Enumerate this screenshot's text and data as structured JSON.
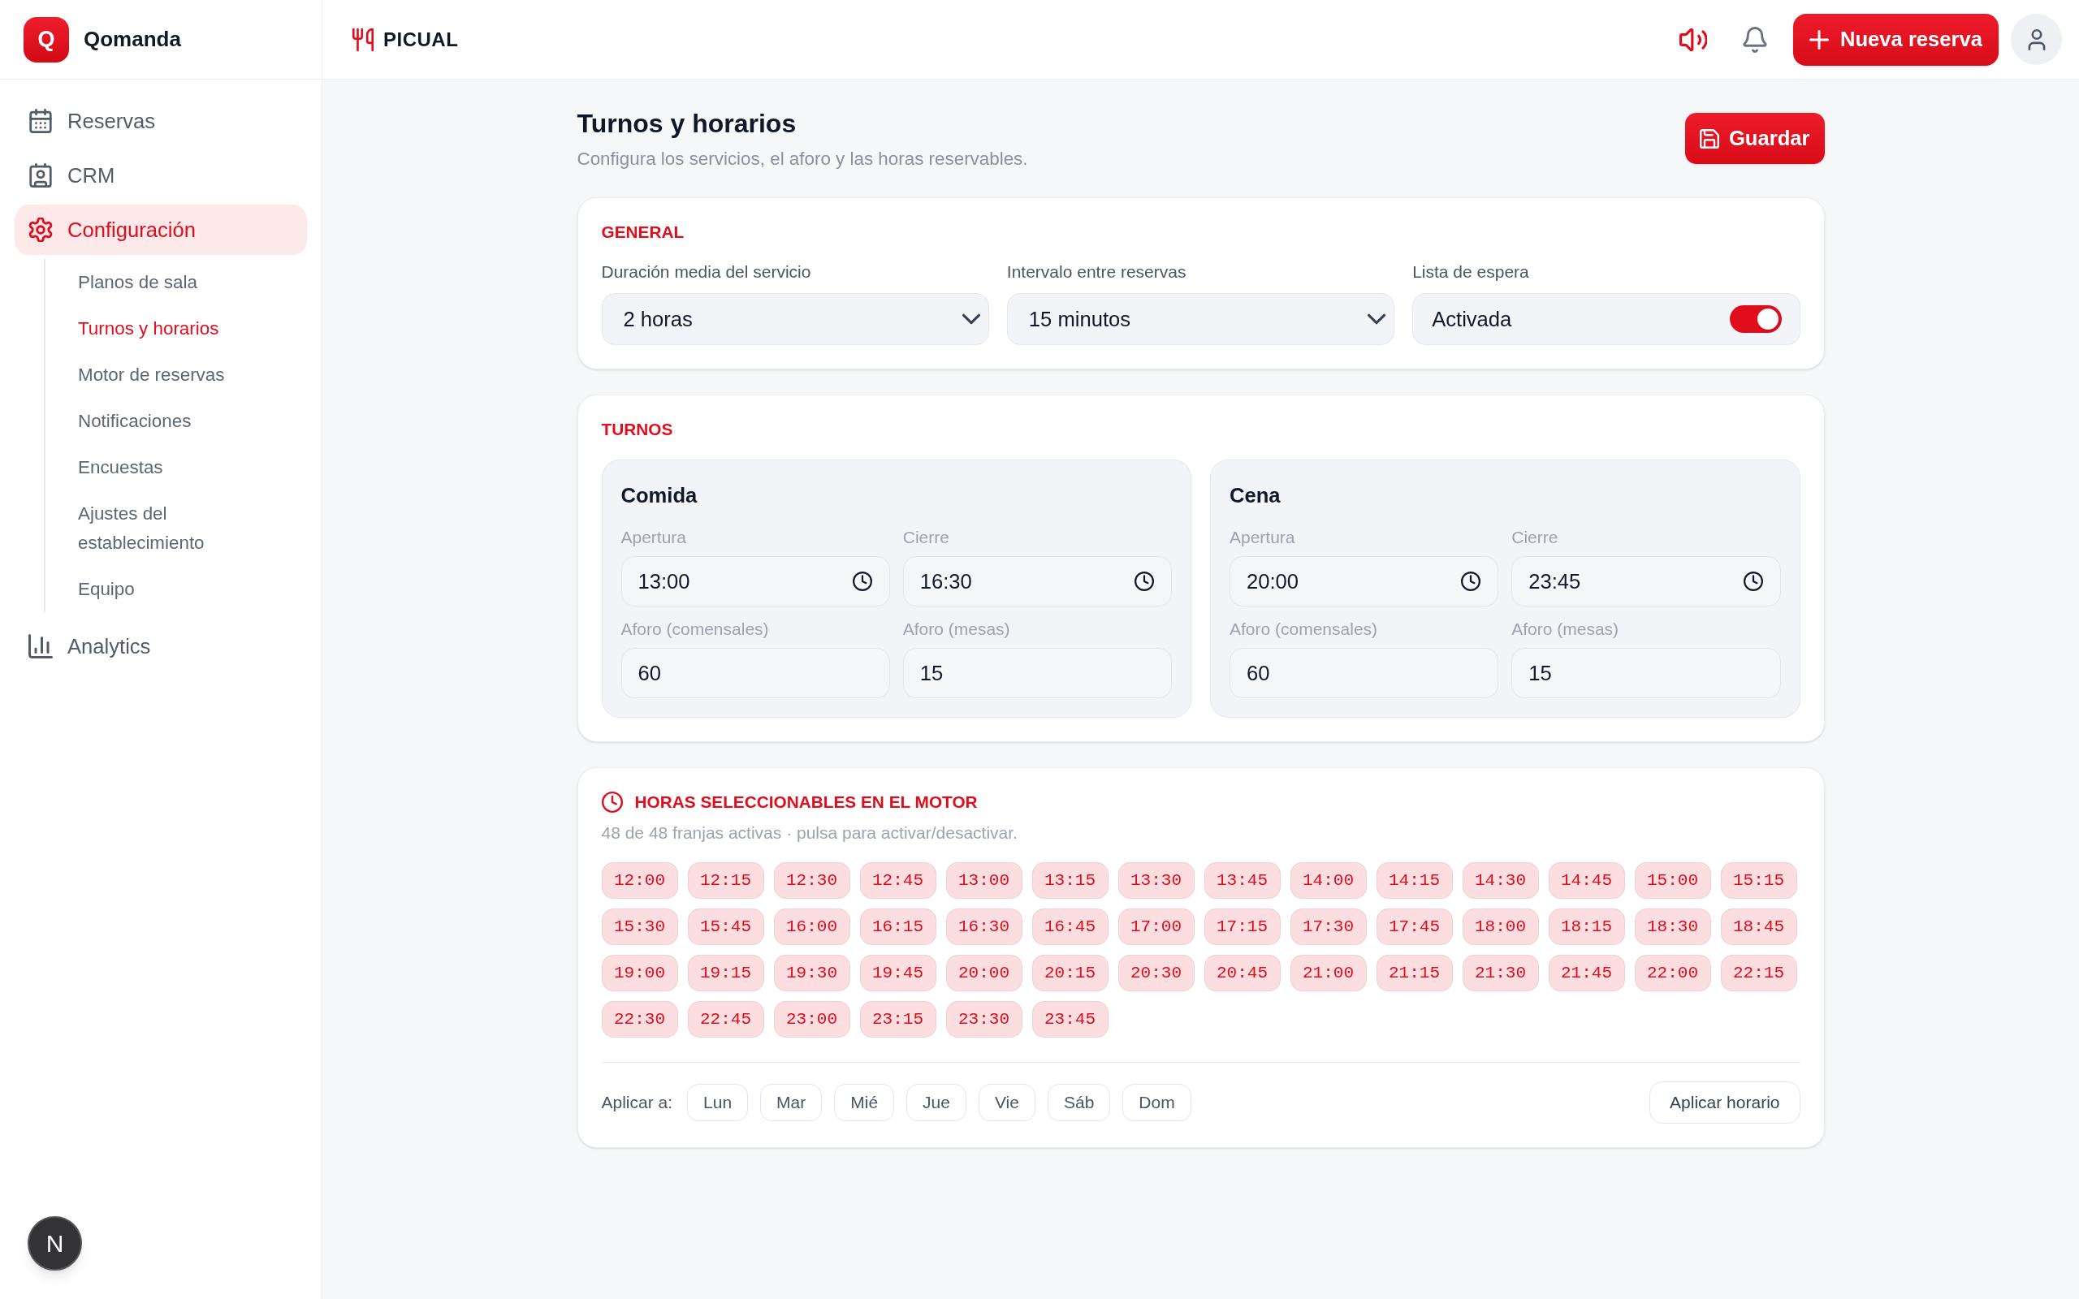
{
  "sidebar": {
    "logo_letter": "Q",
    "app_name": "Qomanda",
    "items": [
      {
        "label": "Reservas",
        "selected": false
      },
      {
        "label": "CRM",
        "selected": false
      },
      {
        "label": "Configuración",
        "selected": true,
        "children": [
          {
            "label": "Planos de sala",
            "selected": false
          },
          {
            "label": "Turnos y horarios",
            "selected": true
          },
          {
            "label": "Motor de reservas",
            "selected": false
          },
          {
            "label": "Notificaciones",
            "selected": false
          },
          {
            "label": "Encuestas",
            "selected": false
          },
          {
            "label": "Ajustes del establecimiento",
            "selected": false
          },
          {
            "label": "Equipo",
            "selected": false
          }
        ]
      },
      {
        "label": "Analytics",
        "selected": false
      }
    ]
  },
  "floating_button": {
    "label": "N"
  },
  "topbar": {
    "restaurant": "PICUAL",
    "new_button": "Nueva reserva"
  },
  "page": {
    "title": "Turnos y horarios",
    "subtitle": "Configura los servicios, el aforo y las horas reservables.",
    "save_button": "Guardar"
  },
  "general": {
    "heading": "GENERAL",
    "fields": [
      {
        "kind": "select",
        "label": "Duración media del servicio",
        "value": "2 horas"
      },
      {
        "kind": "select",
        "label": "Intervalo entre reservas",
        "value": "15 minutos"
      },
      {
        "kind": "toggle",
        "label": "Lista de espera",
        "value": "Activada",
        "on": true
      }
    ]
  },
  "turnos": {
    "heading": "TURNOS",
    "shifts": [
      {
        "name": "Comida",
        "fields": [
          {
            "kind": "time",
            "label": "Apertura",
            "value": "13:00"
          },
          {
            "kind": "time",
            "label": "Cierre",
            "value": "16:30"
          },
          {
            "kind": "number",
            "label": "Aforo (comensales)",
            "value": "60"
          },
          {
            "kind": "number",
            "label": "Aforo (mesas)",
            "value": "15"
          }
        ]
      },
      {
        "name": "Cena",
        "fields": [
          {
            "kind": "time",
            "label": "Apertura",
            "value": "20:00"
          },
          {
            "kind": "time",
            "label": "Cierre",
            "value": "23:45"
          },
          {
            "kind": "number",
            "label": "Aforo (comensales)",
            "value": "60"
          },
          {
            "kind": "number",
            "label": "Aforo (mesas)",
            "value": "15"
          }
        ]
      }
    ]
  },
  "horas": {
    "heading": "HORAS SELECCIONABLES EN EL MOTOR",
    "summary": "48 de 48 franjas activas · pulsa para activar/desactivar.",
    "slots": [
      {
        "time": "12:00",
        "selected": true
      },
      {
        "time": "12:15",
        "selected": true
      },
      {
        "time": "12:30",
        "selected": true
      },
      {
        "time": "12:45",
        "selected": true
      },
      {
        "time": "13:00",
        "selected": true
      },
      {
        "time": "13:15",
        "selected": true
      },
      {
        "time": "13:30",
        "selected": true
      },
      {
        "time": "13:45",
        "selected": true
      },
      {
        "time": "14:00",
        "selected": true
      },
      {
        "time": "14:15",
        "selected": true
      },
      {
        "time": "14:30",
        "selected": true
      },
      {
        "time": "14:45",
        "selected": true
      },
      {
        "time": "15:00",
        "selected": true
      },
      {
        "time": "15:15",
        "selected": true
      },
      {
        "time": "15:30",
        "selected": true
      },
      {
        "time": "15:45",
        "selected": true
      },
      {
        "time": "16:00",
        "selected": true
      },
      {
        "time": "16:15",
        "selected": true
      },
      {
        "time": "16:30",
        "selected": true
      },
      {
        "time": "16:45",
        "selected": true
      },
      {
        "time": "17:00",
        "selected": true
      },
      {
        "time": "17:15",
        "selected": true
      },
      {
        "time": "17:30",
        "selected": true
      },
      {
        "time": "17:45",
        "selected": true
      },
      {
        "time": "18:00",
        "selected": true
      },
      {
        "time": "18:15",
        "selected": true
      },
      {
        "time": "18:30",
        "selected": true
      },
      {
        "time": "18:45",
        "selected": true
      },
      {
        "time": "19:00",
        "selected": true
      },
      {
        "time": "19:15",
        "selected": true
      },
      {
        "time": "19:30",
        "selected": true
      },
      {
        "time": "19:45",
        "selected": true
      },
      {
        "time": "20:00",
        "selected": true
      },
      {
        "time": "20:15",
        "selected": true
      },
      {
        "time": "20:30",
        "selected": true
      },
      {
        "time": "20:45",
        "selected": true
      },
      {
        "time": "21:00",
        "selected": true
      },
      {
        "time": "21:15",
        "selected": true
      },
      {
        "time": "21:30",
        "selected": true
      },
      {
        "time": "21:45",
        "selected": true
      },
      {
        "time": "22:00",
        "selected": true
      },
      {
        "time": "22:15",
        "selected": true
      },
      {
        "time": "22:30",
        "selected": true
      },
      {
        "time": "22:45",
        "selected": true
      },
      {
        "time": "23:00",
        "selected": true
      },
      {
        "time": "23:15",
        "selected": true
      },
      {
        "time": "23:30",
        "selected": true
      },
      {
        "time": "23:45",
        "selected": true
      }
    ],
    "apply_label": "Aplicar a:",
    "days": [
      {
        "label": "Lun",
        "selected": false
      },
      {
        "label": "Mar",
        "selected": false
      },
      {
        "label": "Mié",
        "selected": false
      },
      {
        "label": "Jue",
        "selected": false
      },
      {
        "label": "Vie",
        "selected": false
      },
      {
        "label": "Sáb",
        "selected": false
      },
      {
        "label": "Dom",
        "selected": false
      }
    ],
    "apply_button": "Aplicar horario"
  }
}
